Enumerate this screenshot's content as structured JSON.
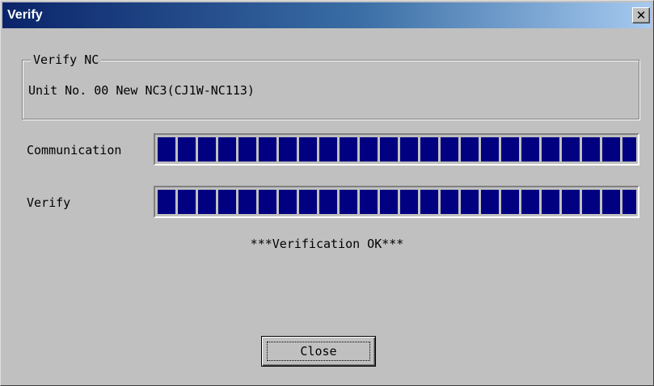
{
  "window": {
    "title": "Verify",
    "close_glyph": "✕",
    "close_icon": "close-icon"
  },
  "group": {
    "legend": "Verify NC",
    "unit_text": "Unit No. 00 New NC3(CJ1W-NC113)"
  },
  "progress": {
    "communication": {
      "label": "Communication",
      "value": 1.0
    },
    "verify": {
      "label": "Verify",
      "value": 1.0
    },
    "color": "#000080"
  },
  "status_text": "***Verification OK***",
  "buttons": {
    "close_label": "Close"
  }
}
